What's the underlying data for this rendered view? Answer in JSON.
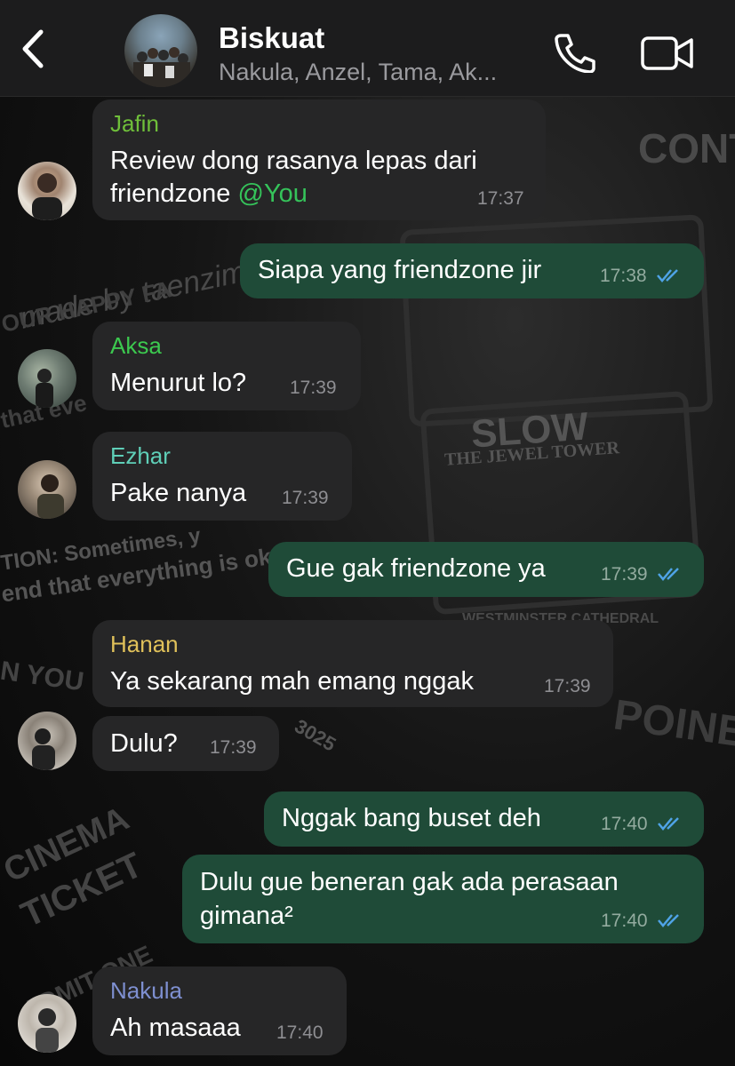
{
  "header": {
    "title": "Biskuat",
    "subtitle": "Nakula, Anzel, Tama, Ak..."
  },
  "wallpaper": {
    "texts": [
      "made by taenzimar",
      "CONT",
      "SLOW",
      "THE JEWEL TOWER",
      "TION: Sometimes, y",
      "end that everything is okay.",
      "WESTMINSTER CATHEDRAL",
      "CINEMA",
      "TICKET",
      "ADMIT ONE",
      "N YOU",
      "POINER",
      "3025",
      "OUR HAPPY FA",
      "that eve"
    ]
  },
  "messages": [
    {
      "sender": "Jafin",
      "sender_color": "#6fbf3a",
      "line1": "Review dong rasanya lepas dari",
      "line2": "friendzone ",
      "mention": "@You",
      "time": "17:37"
    },
    {
      "text": "Siapa yang friendzone jir",
      "time": "17:38"
    },
    {
      "sender": "Aksa",
      "sender_color": "#3cc94f",
      "text": "Menurut lo?",
      "time": "17:39"
    },
    {
      "sender": "Ezhar",
      "sender_color": "#5fcfb8",
      "text": "Pake nanya",
      "time": "17:39"
    },
    {
      "text": "Gue gak friendzone ya",
      "time": "17:39"
    },
    {
      "sender": "Hanan",
      "sender_color": "#e0c15a",
      "text": "Ya sekarang mah emang nggak",
      "time": "17:39"
    },
    {
      "text": "Dulu?",
      "time": "17:39"
    },
    {
      "text": "Nggak bang buset deh",
      "time": "17:40"
    },
    {
      "line1": "Dulu gue beneran gak ada perasaan",
      "line2": "gimana²",
      "time": "17:40"
    },
    {
      "sender": "Nakula",
      "sender_color": "#7e8fd0",
      "text": "Ah masaaa",
      "time": "17:40"
    }
  ],
  "colors": {
    "incoming_bubble": "#262627",
    "outgoing_bubble": "#1f4b38",
    "read_ticks": "#4fa3e6"
  }
}
